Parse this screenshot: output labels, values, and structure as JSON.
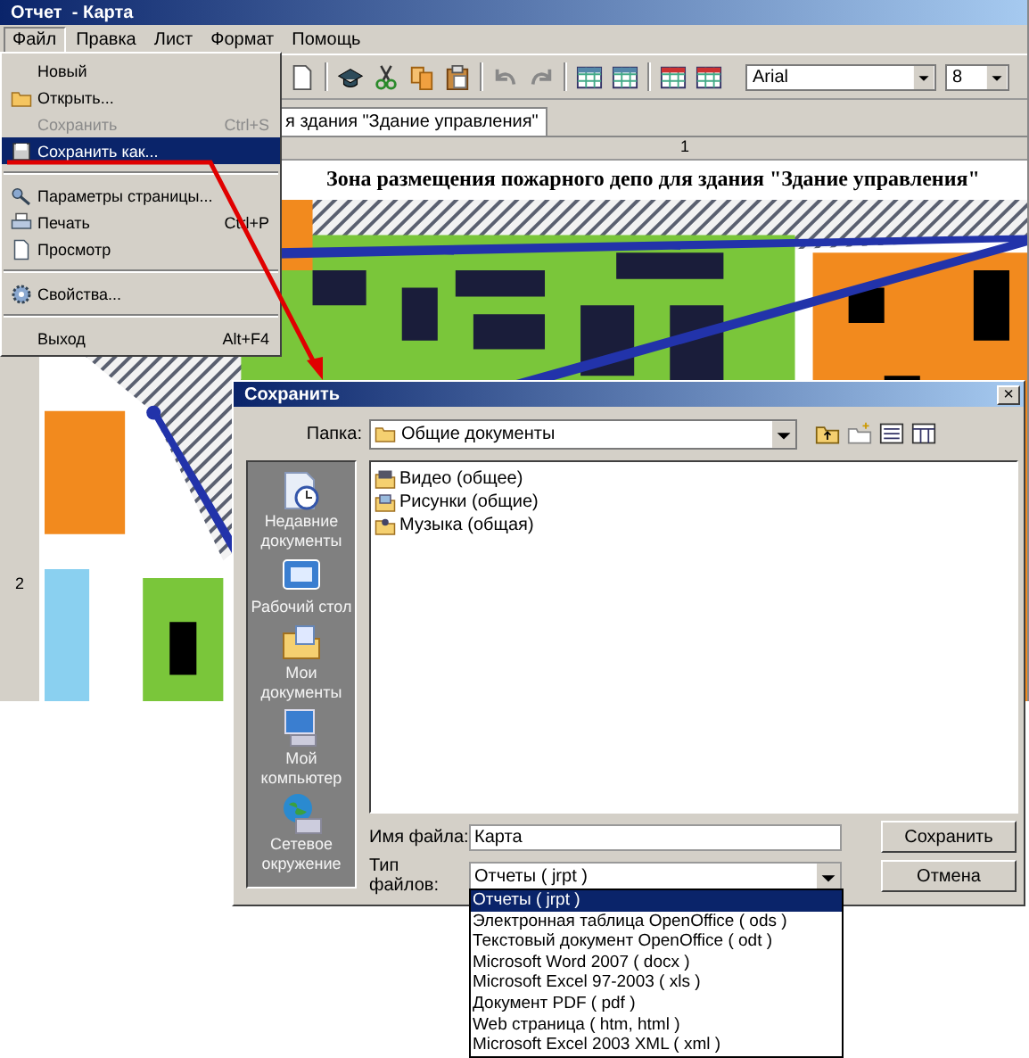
{
  "window": {
    "title": "Отчет  - Карта"
  },
  "menu_bar": [
    {
      "label": "Файл",
      "selected": true
    },
    {
      "label": "Правка",
      "selected": false
    },
    {
      "label": "Лист",
      "selected": false
    },
    {
      "label": "Формат",
      "selected": false
    },
    {
      "label": "Помощь",
      "selected": false
    }
  ],
  "file_menu": [
    {
      "kind": "item",
      "label": "Новый",
      "disabled": false,
      "selected": false
    },
    {
      "kind": "item",
      "label": "Открыть...",
      "disabled": false,
      "selected": false
    },
    {
      "kind": "item",
      "label": "Сохранить",
      "shortcut": "Ctrl+S",
      "disabled": true,
      "selected": false
    },
    {
      "kind": "item",
      "label": "Сохранить как...",
      "disabled": false,
      "selected": true
    },
    {
      "kind": "separator"
    },
    {
      "kind": "item",
      "label": "Параметры страницы...",
      "disabled": false,
      "selected": false
    },
    {
      "kind": "item",
      "label": "Печать",
      "shortcut": "Ctrl+P",
      "disabled": false,
      "selected": false
    },
    {
      "kind": "item",
      "label": "Просмотр",
      "disabled": false,
      "selected": false
    },
    {
      "kind": "separator"
    },
    {
      "kind": "item",
      "label": "Свойства...",
      "disabled": false,
      "selected": false
    },
    {
      "kind": "separator"
    },
    {
      "kind": "item",
      "label": "Выход",
      "shortcut": "Alt+F4",
      "disabled": false,
      "selected": false
    }
  ],
  "toolbar": {
    "font": "Arial",
    "font_size": "8"
  },
  "sheet_tab": "я здания \"Здание управления\"",
  "column_headers": [
    "1"
  ],
  "row_numbers": [
    "2"
  ],
  "report_title": "Зона размещения пожарного депо для здания \"Здание управления\"",
  "save_dialog": {
    "title": "Сохранить",
    "close": "×",
    "folder_label": "Папка:",
    "folder": "Общие документы",
    "places": [
      "Недавние документы",
      "Рабочий стол",
      "Мои документы",
      "Мой компьютер",
      "Сетевое окружение"
    ],
    "files": [
      "Видео (общее)",
      "Рисунки (общие)",
      "Музыка (общая)"
    ],
    "file_name_label": "Имя файла:",
    "file_name": "Карта",
    "file_type_label": "Тип файлов:",
    "file_type": "Отчеты ( jrpt )",
    "buttons": [
      "Сохранить",
      "Отмена"
    ],
    "file_type_options": [
      {
        "label": "Отчеты ( jrpt )",
        "selected": true
      },
      {
        "label": "Электронная таблица OpenOffice ( ods )",
        "selected": false
      },
      {
        "label": "Текстовый документ OpenOffice ( odt )",
        "selected": false
      },
      {
        "label": "Microsoft Word 2007 ( docx )",
        "selected": false
      },
      {
        "label": "Microsoft Excel 97-2003 ( xls )",
        "selected": false
      },
      {
        "label": "Документ PDF ( pdf )",
        "selected": false
      },
      {
        "label": "Web страница ( htm, html )",
        "selected": false
      },
      {
        "label": "Microsoft Excel 2003 XML ( xml )",
        "selected": false
      }
    ]
  }
}
